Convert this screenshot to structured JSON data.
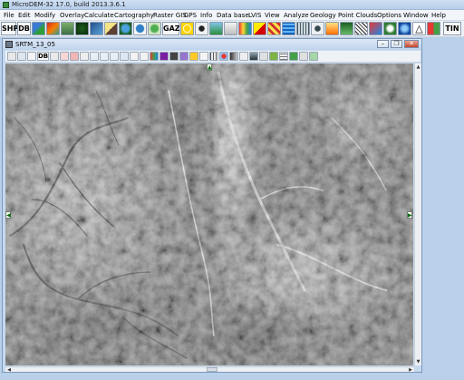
{
  "app": {
    "title": "MicroDEM-32 17.0, build 2013.3.6.1"
  },
  "menu": {
    "items": [
      "File",
      "Edit",
      "Modify",
      "Overlay",
      "Calculate",
      "Cartography",
      "Raster GIS",
      "GPS",
      "Info",
      "Data base",
      "LVIS",
      "View",
      "Analyze",
      "Geology",
      "Point Clouds",
      "Options",
      "Window",
      "Help"
    ]
  },
  "toolbar": {
    "shp_label": "SHP",
    "db_label": "DB",
    "gaz_label": "GAZ",
    "tin_label": "TIN"
  },
  "child_window": {
    "title": "SRTM_13_05",
    "minimize_glyph": "–",
    "restore_glyph": "❐",
    "close_glyph": "✕",
    "db_label": "DB"
  },
  "icons": {
    "toolbar": [
      "shapefile",
      "database",
      "globe-map",
      "color-palette",
      "terrain-3d",
      "dem-green",
      "raster-blue",
      "pencil-edit",
      "world-globe",
      "earth-globe",
      "tree-green",
      "gazetteer",
      "sun",
      "flower",
      "satellite-image",
      "envelope",
      "spectrum",
      "triangle-warning",
      "stripes-yellow",
      "wave-blue",
      "grid-net",
      "compass",
      "pyramid",
      "layers",
      "glove-globe",
      "triangle-outline",
      "windows-flag",
      "tin"
    ],
    "map_toolbar": [
      "print",
      "print-preview",
      "copy",
      "database",
      "zoom-box",
      "cancel",
      "red-x",
      "pan",
      "zoom-in",
      "zoom-in-2",
      "zoom-out",
      "refresh",
      "cursor",
      "identify",
      "rgb",
      "purple-shape",
      "dark-shape",
      "globe",
      "grid",
      "overlay-red",
      "strip",
      "pen",
      "profile",
      "scale",
      "legend",
      "grid-2",
      "map-green",
      "print-2",
      "export"
    ]
  },
  "scroll": {
    "left_arrow": "◀",
    "right_arrow": "▶",
    "up_arrow": "▲",
    "down_arrow": "▼"
  },
  "nav_arrows": {
    "top": "▲",
    "left": "◀",
    "right": "▶"
  }
}
